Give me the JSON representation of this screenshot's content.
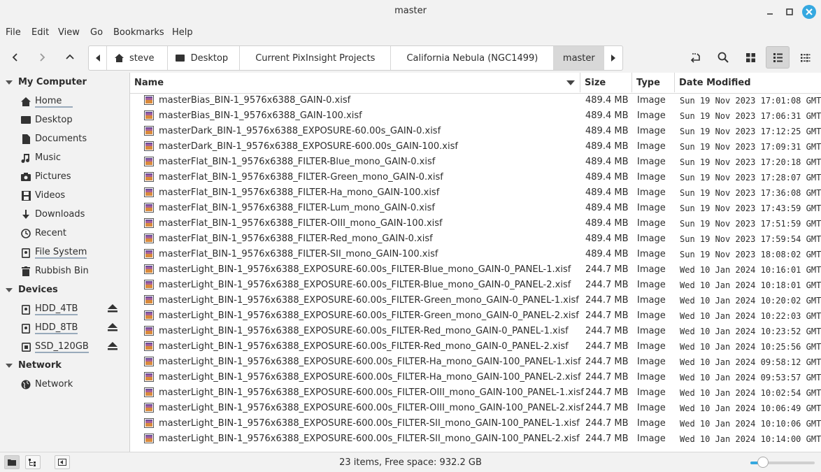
{
  "window": {
    "title": "master"
  },
  "menu": [
    "File",
    "Edit",
    "View",
    "Go",
    "Bookmarks",
    "Help"
  ],
  "breadcrumbs": [
    "steve",
    "Desktop",
    "Current PixInsight Projects",
    "California Nebula (NGC1499)",
    "master"
  ],
  "sidebar": {
    "my_computer": {
      "heading": "My Computer",
      "items": [
        {
          "label": "Home",
          "icon": "home-icon"
        },
        {
          "label": "Desktop",
          "icon": "desktop-icon"
        },
        {
          "label": "Documents",
          "icon": "document-icon"
        },
        {
          "label": "Music",
          "icon": "music-icon"
        },
        {
          "label": "Pictures",
          "icon": "camera-icon"
        },
        {
          "label": "Videos",
          "icon": "film-icon"
        },
        {
          "label": "Downloads",
          "icon": "download-icon"
        },
        {
          "label": "Recent",
          "icon": "clock-icon"
        },
        {
          "label": "File System",
          "icon": "drive-icon"
        },
        {
          "label": "Rubbish Bin",
          "icon": "trash-icon"
        }
      ]
    },
    "devices": {
      "heading": "Devices",
      "items": [
        {
          "label": "HDD_4TB",
          "icon": "drive-icon"
        },
        {
          "label": "HDD_8TB",
          "icon": "drive-icon"
        },
        {
          "label": "SSD_120GB",
          "icon": "chip-icon"
        }
      ]
    },
    "network": {
      "heading": "Network",
      "items": [
        {
          "label": "Network",
          "icon": "globe-icon"
        }
      ]
    }
  },
  "columns": {
    "name": "Name",
    "size": "Size",
    "type": "Type",
    "date": "Date Modified"
  },
  "files": [
    {
      "name": "masterBias_BIN-1_9576x6388_GAIN-0.xisf",
      "size": "489.4 MB",
      "type": "Image",
      "date": "Sun 19 Nov 2023 17:01:08 GMT"
    },
    {
      "name": "masterBias_BIN-1_9576x6388_GAIN-100.xisf",
      "size": "489.4 MB",
      "type": "Image",
      "date": "Sun 19 Nov 2023 17:06:31 GMT"
    },
    {
      "name": "masterDark_BIN-1_9576x6388_EXPOSURE-60.00s_GAIN-0.xisf",
      "size": "489.4 MB",
      "type": "Image",
      "date": "Sun 19 Nov 2023 17:12:25 GMT"
    },
    {
      "name": "masterDark_BIN-1_9576x6388_EXPOSURE-600.00s_GAIN-100.xisf",
      "size": "489.4 MB",
      "type": "Image",
      "date": "Sun 19 Nov 2023 17:09:31 GMT"
    },
    {
      "name": "masterFlat_BIN-1_9576x6388_FILTER-Blue_mono_GAIN-0.xisf",
      "size": "489.4 MB",
      "type": "Image",
      "date": "Sun 19 Nov 2023 17:20:18 GMT"
    },
    {
      "name": "masterFlat_BIN-1_9576x6388_FILTER-Green_mono_GAIN-0.xisf",
      "size": "489.4 MB",
      "type": "Image",
      "date": "Sun 19 Nov 2023 17:28:07 GMT"
    },
    {
      "name": "masterFlat_BIN-1_9576x6388_FILTER-Ha_mono_GAIN-100.xisf",
      "size": "489.4 MB",
      "type": "Image",
      "date": "Sun 19 Nov 2023 17:36:08 GMT"
    },
    {
      "name": "masterFlat_BIN-1_9576x6388_FILTER-Lum_mono_GAIN-0.xisf",
      "size": "489.4 MB",
      "type": "Image",
      "date": "Sun 19 Nov 2023 17:43:59 GMT"
    },
    {
      "name": "masterFlat_BIN-1_9576x6388_FILTER-OIII_mono_GAIN-100.xisf",
      "size": "489.4 MB",
      "type": "Image",
      "date": "Sun 19 Nov 2023 17:51:59 GMT"
    },
    {
      "name": "masterFlat_BIN-1_9576x6388_FILTER-Red_mono_GAIN-0.xisf",
      "size": "489.4 MB",
      "type": "Image",
      "date": "Sun 19 Nov 2023 17:59:54 GMT"
    },
    {
      "name": "masterFlat_BIN-1_9576x6388_FILTER-SII_mono_GAIN-100.xisf",
      "size": "489.4 MB",
      "type": "Image",
      "date": "Sun 19 Nov 2023 18:08:02 GMT"
    },
    {
      "name": "masterLight_BIN-1_9576x6388_EXPOSURE-60.00s_FILTER-Blue_mono_GAIN-0_PANEL-1.xisf",
      "size": "244.7 MB",
      "type": "Image",
      "date": "Wed 10 Jan 2024 10:16:01 GMT"
    },
    {
      "name": "masterLight_BIN-1_9576x6388_EXPOSURE-60.00s_FILTER-Blue_mono_GAIN-0_PANEL-2.xisf",
      "size": "244.7 MB",
      "type": "Image",
      "date": "Wed 10 Jan 2024 10:18:01 GMT"
    },
    {
      "name": "masterLight_BIN-1_9576x6388_EXPOSURE-60.00s_FILTER-Green_mono_GAIN-0_PANEL-1.xisf",
      "size": "244.7 MB",
      "type": "Image",
      "date": "Wed 10 Jan 2024 10:20:02 GMT"
    },
    {
      "name": "masterLight_BIN-1_9576x6388_EXPOSURE-60.00s_FILTER-Green_mono_GAIN-0_PANEL-2.xisf",
      "size": "244.7 MB",
      "type": "Image",
      "date": "Wed 10 Jan 2024 10:22:03 GMT"
    },
    {
      "name": "masterLight_BIN-1_9576x6388_EXPOSURE-60.00s_FILTER-Red_mono_GAIN-0_PANEL-1.xisf",
      "size": "244.7 MB",
      "type": "Image",
      "date": "Wed 10 Jan 2024 10:23:52 GMT"
    },
    {
      "name": "masterLight_BIN-1_9576x6388_EXPOSURE-60.00s_FILTER-Red_mono_GAIN-0_PANEL-2.xisf",
      "size": "244.7 MB",
      "type": "Image",
      "date": "Wed 10 Jan 2024 10:25:56 GMT"
    },
    {
      "name": "masterLight_BIN-1_9576x6388_EXPOSURE-600.00s_FILTER-Ha_mono_GAIN-100_PANEL-1.xisf",
      "size": "244.7 MB",
      "type": "Image",
      "date": "Wed 10 Jan 2024 09:58:12 GMT"
    },
    {
      "name": "masterLight_BIN-1_9576x6388_EXPOSURE-600.00s_FILTER-Ha_mono_GAIN-100_PANEL-2.xisf",
      "size": "244.7 MB",
      "type": "Image",
      "date": "Wed 10 Jan 2024 09:53:57 GMT"
    },
    {
      "name": "masterLight_BIN-1_9576x6388_EXPOSURE-600.00s_FILTER-OIII_mono_GAIN-100_PANEL-1.xisf",
      "size": "244.7 MB",
      "type": "Image",
      "date": "Wed 10 Jan 2024 10:02:54 GMT"
    },
    {
      "name": "masterLight_BIN-1_9576x6388_EXPOSURE-600.00s_FILTER-OIII_mono_GAIN-100_PANEL-2.xisf",
      "size": "244.7 MB",
      "type": "Image",
      "date": "Wed 10 Jan 2024 10:06:49 GMT"
    },
    {
      "name": "masterLight_BIN-1_9576x6388_EXPOSURE-600.00s_FILTER-SII_mono_GAIN-100_PANEL-1.xisf",
      "size": "244.7 MB",
      "type": "Image",
      "date": "Wed 10 Jan 2024 10:10:06 GMT"
    },
    {
      "name": "masterLight_BIN-1_9576x6388_EXPOSURE-600.00s_FILTER-SII_mono_GAIN-100_PANEL-2.xisf",
      "size": "244.7 MB",
      "type": "Image",
      "date": "Wed 10 Jan 2024 10:14:00 GMT"
    }
  ],
  "status": {
    "text": "23 items, Free space: 932.2 GB",
    "zoom_fraction": 0.2
  },
  "colors": {
    "accent": "#35a8e0",
    "selected_sidebar_underline": "#99aabb"
  }
}
